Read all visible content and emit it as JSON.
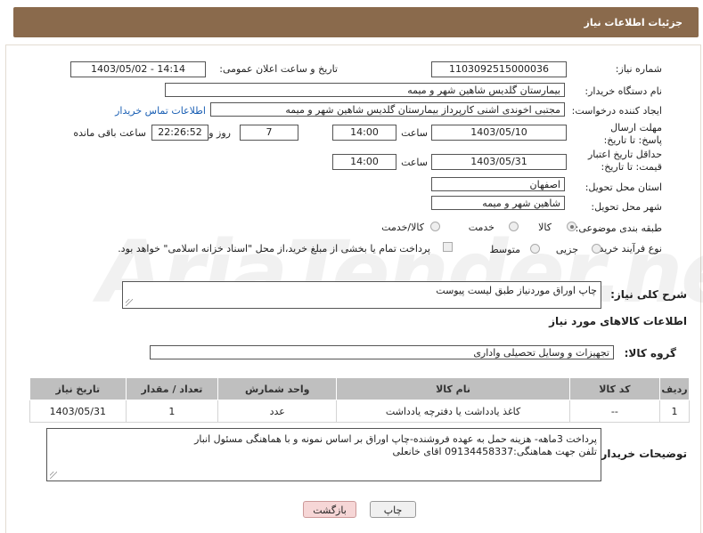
{
  "header": {
    "title": "جزئیات اطلاعات نیاز"
  },
  "fields": {
    "need_number": {
      "label": "شماره نیاز:",
      "value": "1103092515000036"
    },
    "announce_datetime": {
      "label": "تاریخ و ساعت اعلان عمومی:",
      "value": "1403/05/02 - 14:14"
    },
    "buyer_org": {
      "label": "نام دستگاه خریدار:",
      "value": "بیمارستان گلدیس  شاهین شهر و میمه"
    },
    "requester": {
      "label": "ایجاد کننده درخواست:",
      "value": "مجتبی اخوندی اشنی کارپرداز بیمارستان گلدیس  شاهین شهر و میمه",
      "contact_link": "اطلاعات تماس خریدار"
    },
    "reply_deadline": {
      "label": "مهلت ارسال پاسخ: تا تاریخ:",
      "date": "1403/05/10",
      "time_label": "ساعت",
      "time": "14:00",
      "days": "7",
      "days_label": "روز و",
      "remaining": "22:26:52",
      "remaining_label": "ساعت باقی مانده"
    },
    "price_validity": {
      "label": "حداقل تاریخ اعتبار قیمت: تا تاریخ:",
      "date": "1403/05/31",
      "time_label": "ساعت",
      "time": "14:00"
    },
    "province": {
      "label": "استان محل تحویل:",
      "value": "اصفهان"
    },
    "city": {
      "label": "شهر محل تحویل:",
      "value": "شاهین شهر و میمه"
    },
    "category": {
      "label": "طبقه بندی موضوعی:",
      "options": [
        "کالا",
        "خدمت",
        "کالا/خدمت"
      ],
      "selected": "کالا"
    },
    "purchase_type": {
      "label": "نوع فرآیند خرید :",
      "options": [
        "جزیی",
        "متوسط"
      ],
      "note": "پرداخت تمام یا بخشی از مبلغ خرید،از محل \"اسناد خزانه اسلامی\" خواهد بود."
    }
  },
  "description": {
    "label": "شرح کلی نیاز:",
    "value": "چاپ اوراق موردنیاز طبق لیست پیوست"
  },
  "goods_section": {
    "title": "اطلاعات کالاهای مورد نیاز",
    "group_label": "گروه کالا:",
    "group_value": "تجهیزات و وسایل تحصیلی واداری"
  },
  "table": {
    "headers": [
      "ردیف",
      "کد کالا",
      "نام کالا",
      "واحد شمارش",
      "تعداد / مقدار",
      "تاریخ نیاز"
    ],
    "rows": [
      [
        "1",
        "--",
        "کاغذ یادداشت یا دفترچه یادداشت",
        "عدد",
        "1",
        "1403/05/31"
      ]
    ]
  },
  "buyer_notes": {
    "label": "توضیحات خریدار:",
    "line1": "پرداخت 3ماهه- هزینه حمل به عهده فروشنده-چاپ اوراق بر اساس نمونه و با هماهنگی مسئول انبار",
    "line2": "تلفن جهت هماهنگی:09134458337 اقای خانعلی"
  },
  "buttons": {
    "print": "چاپ",
    "back": "بازگشت"
  },
  "watermark": "AriaTender.neT"
}
